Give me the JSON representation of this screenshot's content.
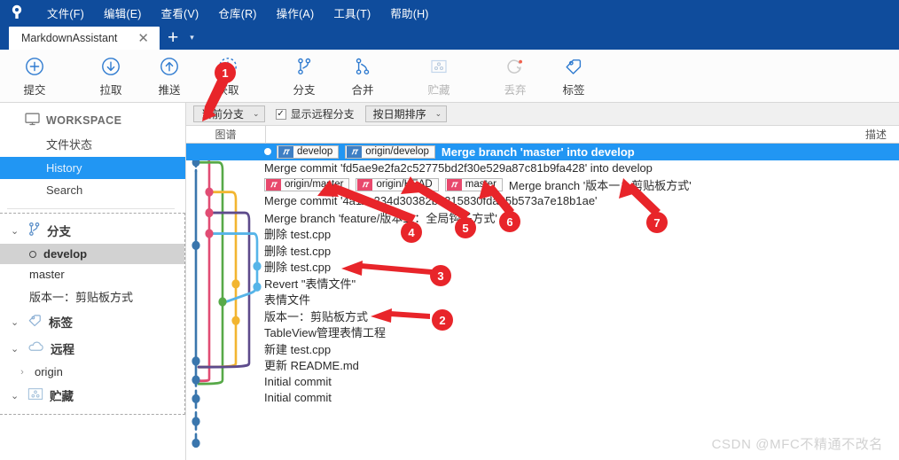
{
  "window": {
    "app_logo_icon": "sourcetree-logo-icon",
    "titlebar_color": "#0F4C9C",
    "accent_color": "#2196f3"
  },
  "menu": {
    "items": [
      {
        "label": "文件(F)",
        "mnemonic": "F"
      },
      {
        "label": "编辑(E)",
        "mnemonic": "E"
      },
      {
        "label": "查看(V)",
        "mnemonic": "V"
      },
      {
        "label": "仓库(R)",
        "mnemonic": "R"
      },
      {
        "label": "操作(A)",
        "mnemonic": "A"
      },
      {
        "label": "工具(T)",
        "mnemonic": "T"
      },
      {
        "label": "帮助(H)",
        "mnemonic": "H"
      }
    ]
  },
  "tabs": {
    "active": "MarkdownAssistant",
    "close_label": "✕",
    "new_tab_label": "+",
    "tab_list_caret": "▾"
  },
  "toolbar": {
    "buttons": [
      {
        "label": "提交",
        "icon": "plus-circle-icon",
        "disabled": false
      },
      {
        "label": "拉取",
        "icon": "arrow-down-circle-icon",
        "disabled": false
      },
      {
        "label": "推送",
        "icon": "arrow-up-circle-icon",
        "disabled": false
      },
      {
        "label": "获取",
        "icon": "fetch-dashed-circle-icon",
        "disabled": false
      },
      {
        "label": "分支",
        "icon": "branch-icon",
        "disabled": false
      },
      {
        "label": "合并",
        "icon": "merge-icon",
        "disabled": false
      },
      {
        "label": "贮藏",
        "icon": "stash-box-icon",
        "disabled": true
      },
      {
        "label": "丢弃",
        "icon": "discard-refresh-icon",
        "disabled": true
      },
      {
        "label": "标签",
        "icon": "tag-icon",
        "disabled": false
      }
    ]
  },
  "sidebar": {
    "workspace": {
      "label": "WORKSPACE",
      "icon": "monitor-icon"
    },
    "nav": [
      {
        "label": "文件状态",
        "selected": false
      },
      {
        "label": "History",
        "selected": true
      },
      {
        "label": "Search",
        "selected": false
      }
    ],
    "sections": [
      {
        "label": "分支",
        "icon": "branch-icon",
        "chevron": "⌄",
        "items": [
          {
            "label": "develop",
            "current": true
          },
          {
            "label": "master",
            "current": false
          },
          {
            "label": "版本一：剪贴板方式",
            "current": false
          }
        ]
      },
      {
        "label": "标签",
        "icon": "tag-icon",
        "chevron": "⌄",
        "items": []
      },
      {
        "label": "远程",
        "icon": "cloud-icon",
        "chevron": "⌄",
        "items": [
          {
            "label": "origin",
            "current": false,
            "expandable": true
          }
        ]
      },
      {
        "label": "贮藏",
        "icon": "stash-box-icon",
        "chevron": "⌄",
        "items": []
      }
    ]
  },
  "filterbar": {
    "branch_filter": {
      "value": "当前分支",
      "caret": "⌄"
    },
    "show_remote_branches": {
      "label": "显示远程分支",
      "checked": true,
      "mark": "✓"
    },
    "sort_order": {
      "value": "按日期排序",
      "caret": "⌄"
    }
  },
  "columns": {
    "graph": "图谱",
    "description": "描述"
  },
  "commits": [
    {
      "message": "Merge branch 'master' into develop",
      "selected": true,
      "refs": [
        {
          "name": "develop",
          "type": "local",
          "color": "blue"
        },
        {
          "name": "origin/develop",
          "type": "remote",
          "color": "blue"
        }
      ]
    },
    {
      "message": "Merge commit 'fd5ae9e2fa2c52775bd2f30e529a87c81b9fa428' into develop",
      "selected": false,
      "refs": []
    },
    {
      "message": "Merge branch '版本一：剪贴板方式'",
      "selected": false,
      "refs": [
        {
          "name": "origin/master",
          "type": "remote",
          "color": "pink"
        },
        {
          "name": "origin/HEAD",
          "type": "remote",
          "color": "pink"
        },
        {
          "name": "master",
          "type": "local",
          "color": "pink"
        }
      ]
    },
    {
      "message": "Merge commit '4a11e234d30382b3215830fda65b573a7e18b1ae'",
      "selected": false,
      "refs": []
    },
    {
      "message": "Merge branch 'feature/版本二：全局钩子方式'",
      "selected": false,
      "refs": []
    },
    {
      "message": "删除 test.cpp",
      "selected": false,
      "refs": []
    },
    {
      "message": "删除 test.cpp",
      "selected": false,
      "refs": []
    },
    {
      "message": "删除 test.cpp",
      "selected": false,
      "refs": []
    },
    {
      "message": "Revert \"表情文件\"",
      "selected": false,
      "refs": []
    },
    {
      "message": "表情文件",
      "selected": false,
      "refs": []
    },
    {
      "message": "版本一：剪贴板方式",
      "selected": false,
      "refs": []
    },
    {
      "message": "TableView管理表情工程",
      "selected": false,
      "refs": []
    },
    {
      "message": "新建 test.cpp",
      "selected": false,
      "refs": []
    },
    {
      "message": "更新 README.md",
      "selected": false,
      "refs": []
    },
    {
      "message": "Initial commit",
      "selected": false,
      "refs": []
    },
    {
      "message": "Initial commit",
      "selected": false,
      "refs": []
    }
  ],
  "annotations": [
    {
      "number": "1",
      "color": "#e8252a"
    },
    {
      "number": "2",
      "color": "#e8252a"
    },
    {
      "number": "3",
      "color": "#e8252a"
    },
    {
      "number": "4",
      "color": "#e8252a"
    },
    {
      "number": "5",
      "color": "#e8252a"
    },
    {
      "number": "6",
      "color": "#e8252a"
    },
    {
      "number": "7",
      "color": "#e8252a"
    }
  ],
  "watermark": {
    "text": "CSDN @MFC不精通不改名"
  }
}
